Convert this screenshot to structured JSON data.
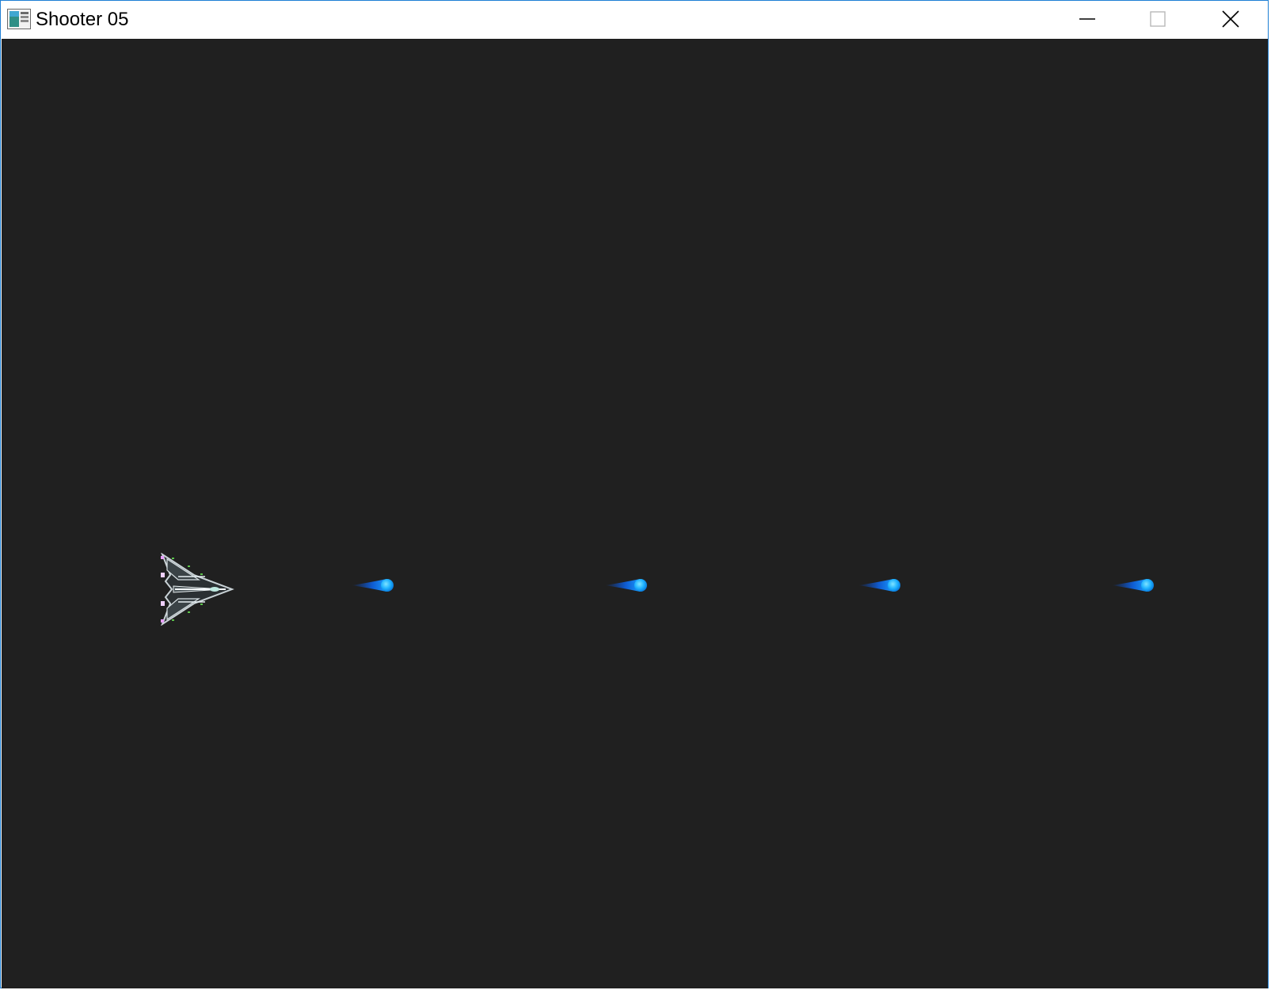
{
  "window": {
    "title": "Shooter 05",
    "app_icon": "window-app-icon",
    "controls": {
      "minimize_icon": "minimize-icon",
      "maximize_icon": "maximize-icon",
      "close_icon": "close-icon"
    }
  },
  "game": {
    "background_color": "#202020",
    "player": {
      "sprite": "fighter-ship-icon",
      "facing": "right"
    },
    "bullets": [
      {
        "color": "#1a9cff"
      },
      {
        "color": "#1a9cff"
      },
      {
        "color": "#1a9cff"
      },
      {
        "color": "#1a9cff"
      }
    ]
  },
  "colors": {
    "border": "#1e7fd4",
    "bullet_core": "#2ab8ff",
    "bullet_tail": "#0b4fd6"
  }
}
